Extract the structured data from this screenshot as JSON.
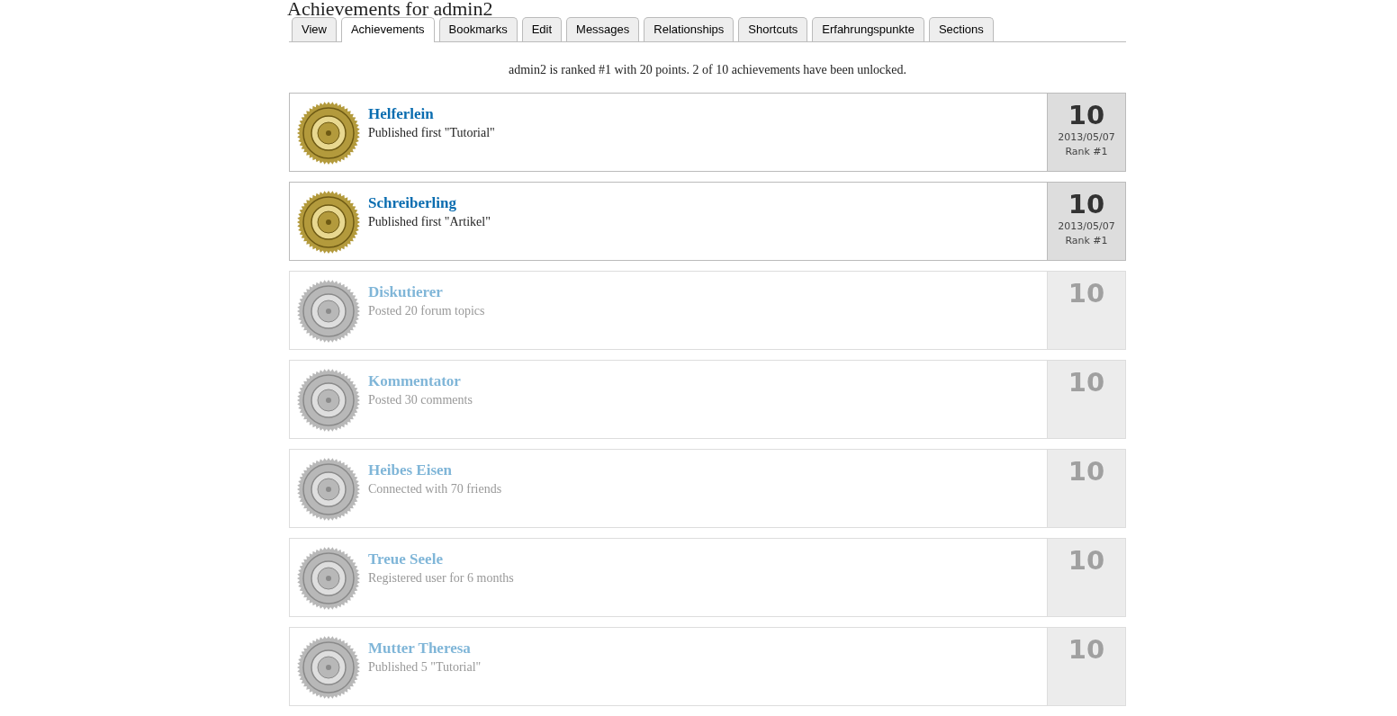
{
  "page": {
    "title": "Achievements for admin2"
  },
  "tabs": [
    {
      "label": "View",
      "selected": false
    },
    {
      "label": "Achievements",
      "selected": true
    },
    {
      "label": "Bookmarks",
      "selected": false
    },
    {
      "label": "Edit",
      "selected": false
    },
    {
      "label": "Messages",
      "selected": false
    },
    {
      "label": "Relationships",
      "selected": false
    },
    {
      "label": "Shortcuts",
      "selected": false
    },
    {
      "label": "Erfahrungspunkte",
      "selected": false
    },
    {
      "label": "Sections",
      "selected": false
    }
  ],
  "summary": "admin2 is ranked #1 with 20 points. 2 of 10 achievements have been unlocked.",
  "achievements": [
    {
      "title": "Helferlein",
      "description": "Published first \"Tutorial\"",
      "points": "10",
      "unlocked": true,
      "date": "2013/05/07",
      "rank": "Rank #1"
    },
    {
      "title": "Schreiberling",
      "description": "Published first \"Artikel\"",
      "points": "10",
      "unlocked": true,
      "date": "2013/05/07",
      "rank": "Rank #1"
    },
    {
      "title": "Diskutierer",
      "description": "Posted 20 forum topics",
      "points": "10",
      "unlocked": false
    },
    {
      "title": "Kommentator",
      "description": "Posted 30 comments",
      "points": "10",
      "unlocked": false
    },
    {
      "title": "Heibes Eisen",
      "description": "Connected with 70 friends",
      "points": "10",
      "unlocked": false
    },
    {
      "title": "Treue Seele",
      "description": "Registered user for 6 months",
      "points": "10",
      "unlocked": false
    },
    {
      "title": "Mutter Theresa",
      "description": "Published 5 \"Tutorial\"",
      "points": "10",
      "unlocked": false
    }
  ]
}
